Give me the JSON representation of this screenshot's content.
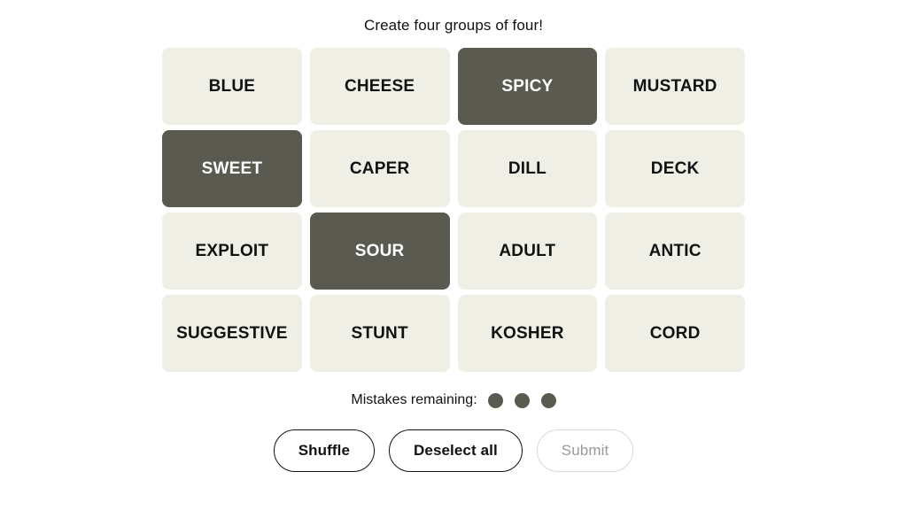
{
  "header": {
    "instructions": "Create four groups of four!"
  },
  "board": {
    "columns": 4,
    "rows": 4,
    "tile_colors": {
      "unselected_bg": "#efefe6",
      "unselected_text": "#121212",
      "selected_bg": "#5a5a50",
      "selected_text": "#ffffff"
    },
    "tiles": [
      {
        "word": "BLUE",
        "selected": false
      },
      {
        "word": "CHEESE",
        "selected": false
      },
      {
        "word": "SPICY",
        "selected": true
      },
      {
        "word": "MUSTARD",
        "selected": false
      },
      {
        "word": "SWEET",
        "selected": true
      },
      {
        "word": "CAPER",
        "selected": false
      },
      {
        "word": "DILL",
        "selected": false
      },
      {
        "word": "DECK",
        "selected": false
      },
      {
        "word": "EXPLOIT",
        "selected": false
      },
      {
        "word": "SOUR",
        "selected": true
      },
      {
        "word": "ADULT",
        "selected": false
      },
      {
        "word": "ANTIC",
        "selected": false
      },
      {
        "word": "SUGGESTIVE",
        "selected": false
      },
      {
        "word": "STUNT",
        "selected": false
      },
      {
        "word": "KOSHER",
        "selected": false
      },
      {
        "word": "CORD",
        "selected": false
      }
    ]
  },
  "mistakes": {
    "label": "Mistakes remaining:",
    "remaining": 3,
    "bubble_color": "#5a5a50"
  },
  "controls": {
    "shuffle_label": "Shuffle",
    "deselect_label": "Deselect all",
    "submit_label": "Submit",
    "submit_disabled": true
  }
}
